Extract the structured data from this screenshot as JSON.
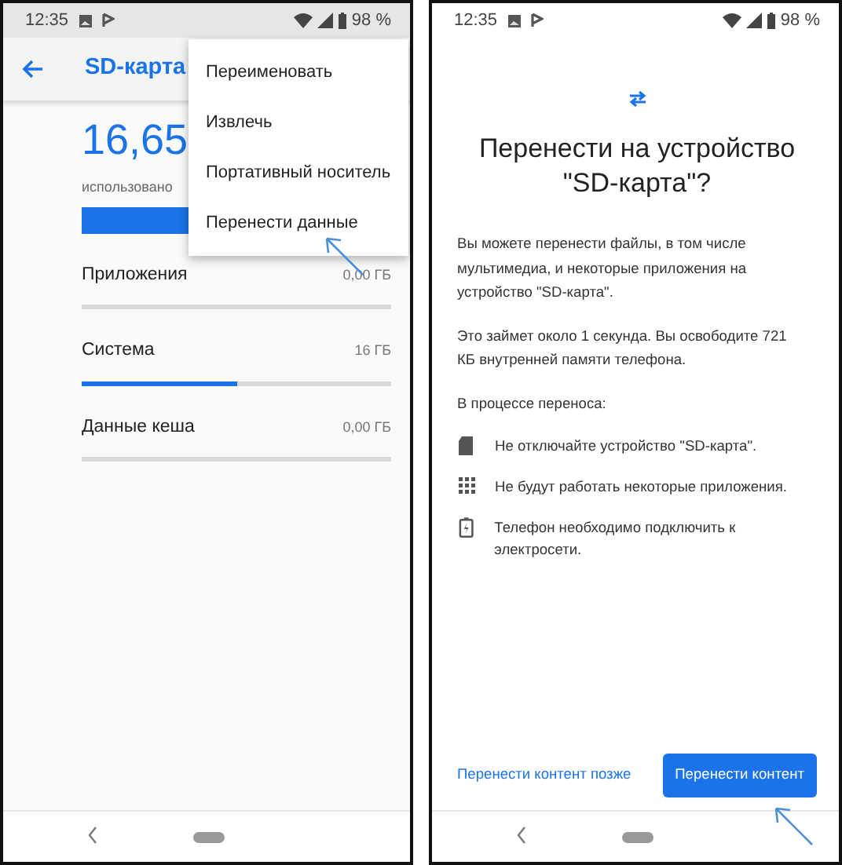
{
  "storage_screen": {
    "status_bar": {
      "time": "12:35",
      "battery": "98 %"
    },
    "toolbar": {
      "title": "SD-карта"
    },
    "summary": {
      "amount": "16,65",
      "caption": "использовано"
    },
    "categories": [
      {
        "name": "Приложения",
        "size": "0,00 ГБ",
        "level": 0
      },
      {
        "name": "Система",
        "size": "16 ГБ",
        "level": 0.5
      },
      {
        "name": "Данные кеша",
        "size": "0,00 ГБ",
        "level": 0
      }
    ],
    "menu": [
      "Переименовать",
      "Извлечь",
      "Портативный носитель",
      "Перенести данные"
    ]
  },
  "move_screen": {
    "status_bar": {
      "time": "12:35",
      "battery": "98 %"
    },
    "title": "Перенести на устройство \"SD-карта\"?",
    "paragraphs": [
      "Вы можете перенести файлы, в том числе мультимедиа, и некоторые приложения на устройство \"SD-карта\".",
      "Это займет около 1 секунда. Вы освободите 721 КБ внутренней памяти телефона.",
      "В процессе переноса:"
    ],
    "notes": [
      {
        "kind": "sdcard",
        "text": "Не отключайте устройство \"SD-карта\"."
      },
      {
        "kind": "apps",
        "text": "Не будут работать некоторые приложения."
      },
      {
        "kind": "battery",
        "text": "Телефон необходимо подключить к электросети."
      }
    ],
    "buttons": [
      {
        "kind": "text",
        "label": "Перенести контент позже"
      },
      {
        "kind": "filled",
        "label": "Перенести контент"
      }
    ]
  }
}
